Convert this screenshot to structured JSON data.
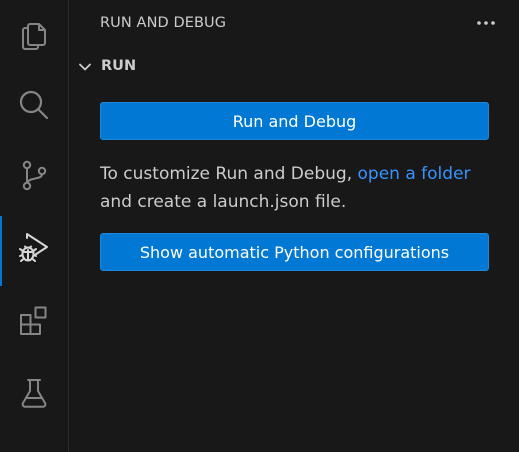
{
  "activity_bar": {
    "items": [
      {
        "name": "explorer",
        "icon": "files-icon"
      },
      {
        "name": "search",
        "icon": "search-icon"
      },
      {
        "name": "source-control",
        "icon": "source-control-icon"
      },
      {
        "name": "run-and-debug",
        "icon": "run-debug-icon",
        "active": true
      },
      {
        "name": "extensions",
        "icon": "extensions-icon"
      },
      {
        "name": "testing",
        "icon": "flask-icon"
      }
    ]
  },
  "sidebar": {
    "title": "RUN AND DEBUG",
    "more_icon": "ellipsis-icon",
    "section": {
      "title": "RUN",
      "expanded": true
    },
    "run_button_label": "Run and Debug",
    "message": {
      "before_link": "To customize Run and Debug, ",
      "link_text": "open a folder",
      "after_link": "and create a launch.json file."
    },
    "python_button_label": "Show automatic Python configurations"
  },
  "colors": {
    "background": "#181818",
    "accent": "#0078d4",
    "link": "#3794ff",
    "icon": "#858585",
    "active_icon": "#d7d7d7"
  }
}
